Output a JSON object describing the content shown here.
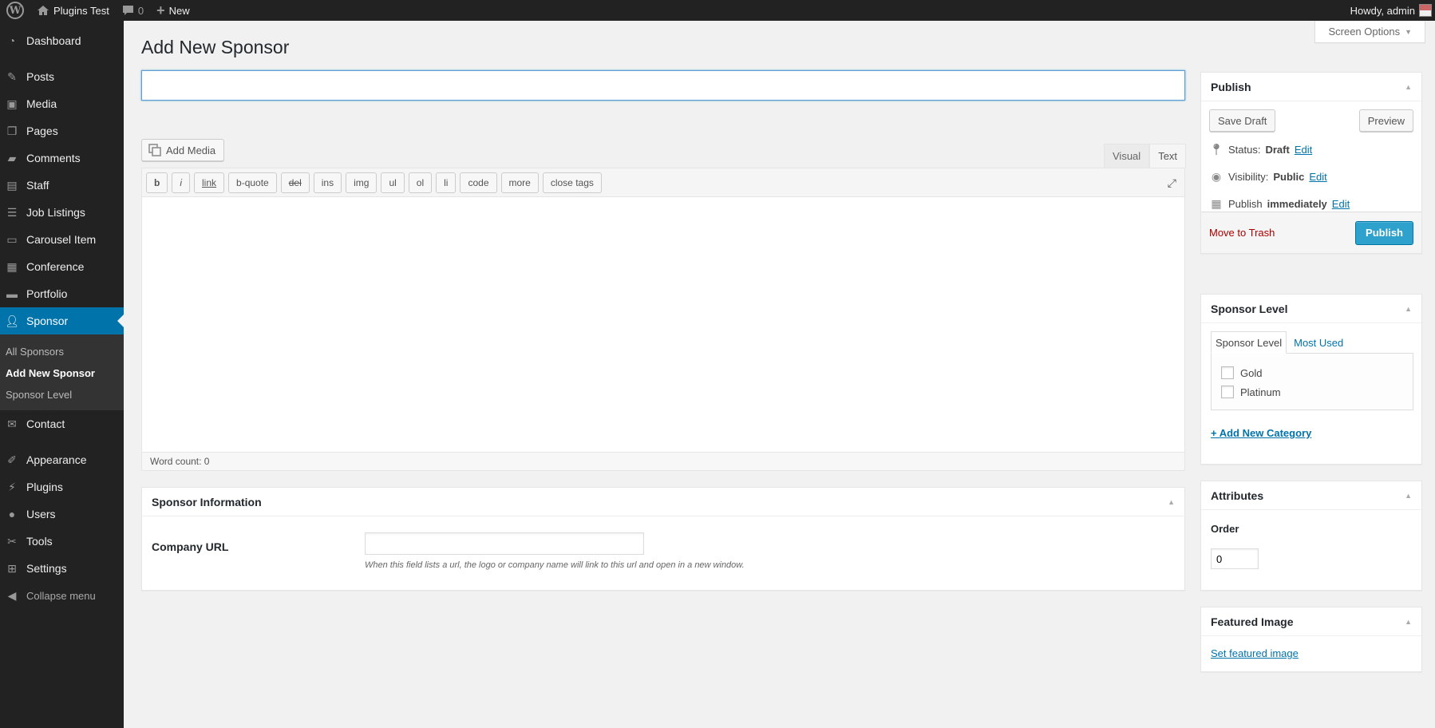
{
  "adminbar": {
    "site_name": "Plugins Test",
    "comments_count": "0",
    "new_label": "New",
    "howdy": "Howdy, admin"
  },
  "sidebar": {
    "items": [
      {
        "label": "Dashboard",
        "icon": "dashboard-icon"
      },
      {
        "label": "Posts",
        "icon": "pin-icon"
      },
      {
        "label": "Media",
        "icon": "media-icon"
      },
      {
        "label": "Pages",
        "icon": "pages-icon"
      },
      {
        "label": "Comments",
        "icon": "comment-icon"
      },
      {
        "label": "Staff",
        "icon": "id-card-icon"
      },
      {
        "label": "Job Listings",
        "icon": "list-icon"
      },
      {
        "label": "Carousel Item",
        "icon": "carousel-icon"
      },
      {
        "label": "Conference",
        "icon": "briefcase-icon"
      },
      {
        "label": "Portfolio",
        "icon": "folder-icon"
      },
      {
        "label": "Sponsor",
        "icon": "person-icon"
      },
      {
        "label": "Contact",
        "icon": "mail-icon"
      },
      {
        "label": "Appearance",
        "icon": "brush-icon"
      },
      {
        "label": "Plugins",
        "icon": "plugin-icon"
      },
      {
        "label": "Users",
        "icon": "user-icon"
      },
      {
        "label": "Tools",
        "icon": "wrench-icon"
      },
      {
        "label": "Settings",
        "icon": "settings-icon"
      }
    ],
    "submenu": [
      "All Sponsors",
      "Add New Sponsor",
      "Sponsor Level"
    ],
    "collapse": "Collapse menu"
  },
  "header": {
    "screen_options": "Screen Options",
    "title": "Add New Sponsor"
  },
  "editor": {
    "title_value": "",
    "add_media": "Add Media",
    "tab_visual": "Visual",
    "tab_text": "Text",
    "quicktags": [
      "b",
      "i",
      "link",
      "b-quote",
      "del",
      "ins",
      "img",
      "ul",
      "ol",
      "li",
      "code",
      "more",
      "close tags"
    ],
    "content": "",
    "word_count": "Word count: 0"
  },
  "sponsor_info": {
    "title": "Sponsor Information",
    "company_url_label": "Company URL",
    "company_url_value": "",
    "help": "When this field lists a url, the logo or company name will link to this url and open in a new window."
  },
  "publish": {
    "title": "Publish",
    "save_draft": "Save Draft",
    "preview": "Preview",
    "status_label": "Status:",
    "status_value": "Draft",
    "visibility_label": "Visibility:",
    "visibility_value": "Public",
    "publish_label": "Publish",
    "publish_value": "immediately",
    "edit": "Edit",
    "trash": "Move to Trash",
    "publish_button": "Publish"
  },
  "sponsor_level": {
    "title": "Sponsor Level",
    "tab_all": "Sponsor Level",
    "tab_most_used": "Most Used",
    "options": [
      "Gold",
      "Platinum"
    ],
    "add_new": "+ Add New Category"
  },
  "attributes": {
    "title": "Attributes",
    "order_label": "Order",
    "order_value": "0"
  },
  "featured_image": {
    "title": "Featured Image",
    "set_link": "Set featured image"
  },
  "colors": {
    "accent": "#0073aa",
    "primary_button": "#2ea2cc",
    "trash": "#a00000",
    "sidebar_bg": "#222222"
  }
}
